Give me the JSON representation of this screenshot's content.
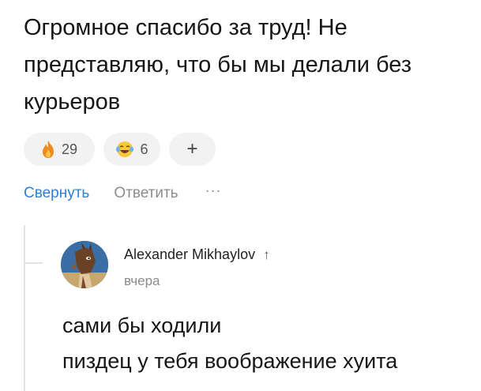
{
  "comment": {
    "text_lines": [
      "Огромное спасибо за труд! Не",
      "представляю, что бы мы делали без",
      "курьеров"
    ],
    "reactions": [
      {
        "icon": "fire-icon",
        "count": "29"
      },
      {
        "icon": "laughing-tears-icon",
        "count": "6"
      },
      {
        "icon": "add-reaction-icon",
        "label": "+"
      }
    ],
    "actions": {
      "collapse": "Свернуть",
      "reply": "Ответить",
      "more": "···"
    }
  },
  "reply": {
    "author": "Alexander Mikhaylov",
    "author_badge_icon": "up-arrow-icon",
    "badge": "↑",
    "time": "вчера",
    "text_lines": [
      "сами бы ходили",
      "пиздец у тебя воображение хуита"
    ]
  },
  "colors": {
    "link": "#2e7fd6",
    "muted": "#8c8c8c",
    "chip": "#f2f2f2"
  }
}
